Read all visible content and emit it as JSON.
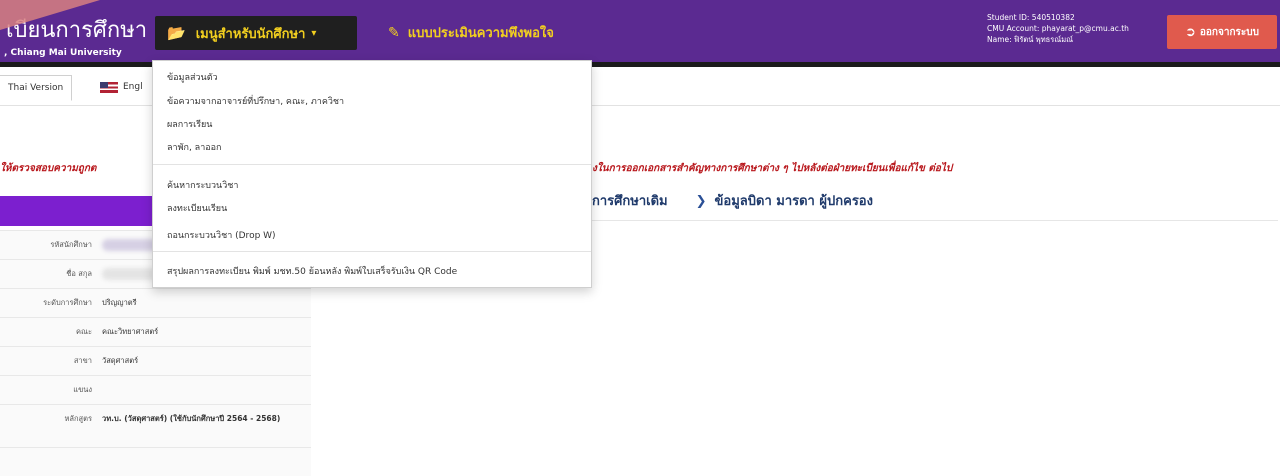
{
  "header": {
    "brand_title": "เบียนการศึกษา",
    "brand_sub": ", Chiang Mai University",
    "menu_label": "เมนูสำหรับนักศึกษา",
    "survey_label": "แบบประเมินความพึงพอใจ",
    "user_lines": [
      "Student ID: 540510382",
      "CMU Account: phayarat_p@cmu.ac.th",
      "Name: ฟิรัตน์ พุทธรณ์มณ์"
    ],
    "logout_label": "ออกจากระบบ"
  },
  "lang": {
    "thai": "Thai Version",
    "eng": "Engl"
  },
  "dropdown": {
    "items": [
      "ข้อมูลส่วนตัว",
      "ข้อความจากอาจารย์ที่ปรึกษา, คณะ, ภาควิชา",
      "ผลการเรียน",
      "ลาพัก, ลาออก",
      "ค้นหากระบวนวิชา",
      "ลงทะเบียนเรียน",
      "ถอนกระบวนวิชา (Drop W)",
      "สรุปผลการลงทะเบียน พิมพ์ มชท.50 ย้อนหลัง พิมพ์ใบเสร็จรับเงิน QR Code"
    ]
  },
  "notice": {
    "left": "ให้ตรวจสอบความถูกต",
    "right": "งในการออกเอกสารสำคัญทางการศึกษาต่าง ๆ ไปหลังต่อฝ่ายทะเบียนเพื่อแก้ไข ต่อไป"
  },
  "section_tabs": {
    "tab1": "การศึกษาเดิม",
    "tab2": "ข้อมูลบิดา มารดา ผู้ปกครอง"
  },
  "info_rows": [
    {
      "label": "รหัสนักศึกษา",
      "value": ""
    },
    {
      "label": "ชื่อ สกุล",
      "value": ""
    },
    {
      "label": "ระดับการศึกษา",
      "value": "ปริญญาตรี"
    },
    {
      "label": "คณะ",
      "value": "คณะวิทยาศาสตร์"
    },
    {
      "label": "สาขา",
      "value": "วัสดุศาสตร์"
    },
    {
      "label": "แขนง",
      "value": ""
    },
    {
      "label": "หลักสูตร",
      "value": "วท.บ. (วัสดุศาสตร์) (ใช้กับนักศึกษาปี 2564 - 2568)"
    },
    {
      "label": "",
      "value": ""
    }
  ],
  "colors": {
    "topbar": "#5b2a91",
    "menu_text": "#f2cf1f",
    "logout": "#e05a4d",
    "notice": "#b8161b",
    "band": "#7c1fcf"
  }
}
